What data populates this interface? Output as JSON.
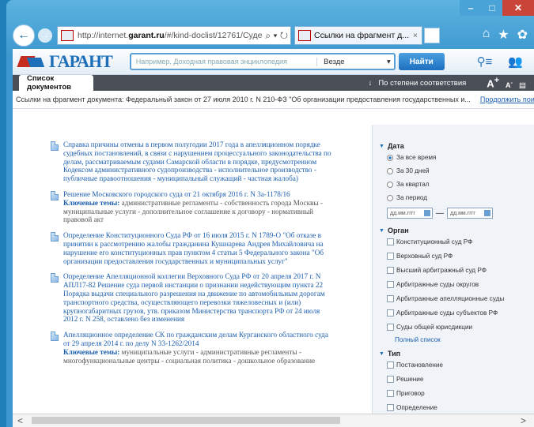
{
  "browser": {
    "url_prefix": "http://internet.",
    "url_domain": "garant.ru",
    "url_suffix": "/#/kind-doclist/12761/Суде",
    "tab_title": "Ссылки на фрагмент д...",
    "tab_close": "×"
  },
  "header": {
    "logo_text": "ГАРАНТ",
    "search_placeholder": "Например, Доходная правовая энциклопедия",
    "search_scope": "Везде",
    "find_label": "Найти"
  },
  "docbar": {
    "tab_label": "Список документов",
    "sort_label": "По степени соответствия",
    "font_big": "A",
    "font_small": "A"
  },
  "breadcrumb": {
    "text": "Ссылки на фрагмент документа: Федеральный закон от 27 июля 2010 г. N 210-ФЗ \"Об организации предоставления государственных и...",
    "link": "Продолжить поиск в онлайн-"
  },
  "documents": [
    {
      "title": "Справка причины отмены в первом полугодии 2017 года в апелляционном порядке судебных постановлений, в связи с нарушением процессуального законодательства по делам, рассматриваемым судами Самарской области в порядке, предусмотренном Кодексом административного судопроизводства - исполнительное производство - публичные правоотношения - муниципальный служащий - частная жалоба)",
      "keywords_label": "",
      "keywords": ""
    },
    {
      "title": "Решение Московского городского суда от 21 октября 2016 г. N 3а-1178/16",
      "keywords_label": "Ключевые темы:",
      "keywords": "административные регламенты - собственность города Москвы - муниципальные услуги - дополнительное соглашение к договору - нормативный правовой акт"
    },
    {
      "title": "Определение Конституционного Суда РФ от 16 июля 2015 г. N 1789-О \"Об отказе в принятии к рассмотрению жалобы гражданина Кушнарева Андрея Михайловича на нарушение его конституционных прав пунктом 4 статьи 5 Федерального закона \"Об организации предоставления государственных и муниципальных услуг\"",
      "keywords_label": "",
      "keywords": ""
    },
    {
      "title": "Определение Апелляционной коллегии Верховного Суда РФ от 20 апреля 2017 г. N АПЛ17-82 Решение суда первой инстанции о признании недействующим пункта 22 Порядка выдачи специального разрешения на движение по автомобильным дорогам транспортного средства, осуществляющего перевозки тяжеловесных и (или) крупногабаритных грузов, утв. приказом Министерства транспорта РФ от 24 июля 2012 г. N 258, оставлено без изменения",
      "keywords_label": "",
      "keywords": ""
    },
    {
      "title": "Апелляционное определение СК по гражданским делам Курганского областного суда от 29 апреля 2014 г. по делу N 33-1262/2014",
      "keywords_label": "Ключевые темы:",
      "keywords": "муниципальные услуги - административные регламенты - многофункциональные центры - социальная политика - дошкольное образование"
    }
  ],
  "filters": {
    "date_header": "Дата",
    "date_options": [
      {
        "label": "За все время",
        "selected": true
      },
      {
        "label": "За 30 дней",
        "selected": false
      },
      {
        "label": "За квартал",
        "selected": false
      },
      {
        "label": "За период",
        "selected": false
      }
    ],
    "date_placeholder": "дд.мм.гггг",
    "date_dash": "—",
    "organ_header": "Орган",
    "organ_options": [
      "Конституционный суд РФ",
      "Верховный суд РФ",
      "Высший арбитражный суд РФ",
      "Арбитражные суды округов",
      "Арбитражные апелляционные суды",
      "Арбитражные суды субъектов РФ",
      "Суды общей юрисдикции"
    ],
    "full_list_link": "Полный список",
    "type_header": "Тип",
    "type_options": [
      "Постановление",
      "Решение",
      "Приговор",
      "Определение"
    ]
  },
  "scroll": {
    "left_arrow": "<",
    "right_arrow": ">"
  }
}
